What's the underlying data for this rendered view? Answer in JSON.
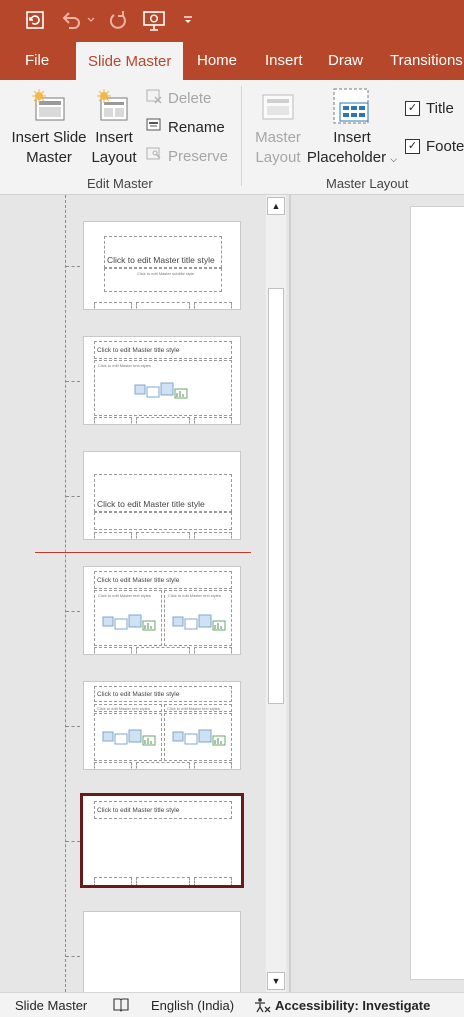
{
  "colors": {
    "accent": "#b7472a",
    "selected_border": "#6b1a1a",
    "insert_marker": "#c0392b"
  },
  "qat": {
    "autosave_icon": "autosave-icon",
    "undo_icon": "undo-icon",
    "redo_icon": "redo-icon",
    "present_icon": "present-from-start-icon",
    "customize_icon": "customize-qat-icon"
  },
  "tabs": [
    {
      "label": "File"
    },
    {
      "label": "Slide Master",
      "active": true
    },
    {
      "label": "Home"
    },
    {
      "label": "Insert"
    },
    {
      "label": "Draw"
    },
    {
      "label": "Transitions"
    }
  ],
  "ribbon": {
    "edit_master": {
      "label": "Edit Master",
      "insert_slide_master": {
        "line1": "Insert Slide",
        "line2": "Master"
      },
      "insert_layout": {
        "line1": "Insert",
        "line2": "Layout"
      },
      "delete": "Delete",
      "rename": "Rename",
      "preserve": "Preserve"
    },
    "master_layout": {
      "label": "Master Layout",
      "master_layout_btn": {
        "line1": "Master",
        "line2": "Layout"
      },
      "insert_placeholder": {
        "line1": "Insert",
        "line2": "Placeholder"
      },
      "title_check": "Title",
      "footers_check": "Foote"
    }
  },
  "thumbnails": [
    {
      "title": "Click to edit Master title style",
      "subtitle": "Click to edit Master subtitle style"
    },
    {
      "title": "Click to edit Master title style",
      "body": "Click to edit Master text styles"
    },
    {
      "title": "Click to edit Master title style"
    },
    {
      "title": "Click to edit Master title style",
      "body_left": "Click to edit Master text styles",
      "body_right": "Click to edit Master text styles"
    },
    {
      "title": "Click to edit Master title style",
      "head_left": "Click to edit Master text styles",
      "head_right": "Click to edit Master text styles"
    },
    {
      "title": "Click to edit Master title style"
    },
    {
      "title": ""
    }
  ],
  "status": {
    "view": "Slide Master",
    "notes_icon": "spelling-check-icon",
    "language": "English (India)",
    "accessibility": "Accessibility: Investigate"
  }
}
